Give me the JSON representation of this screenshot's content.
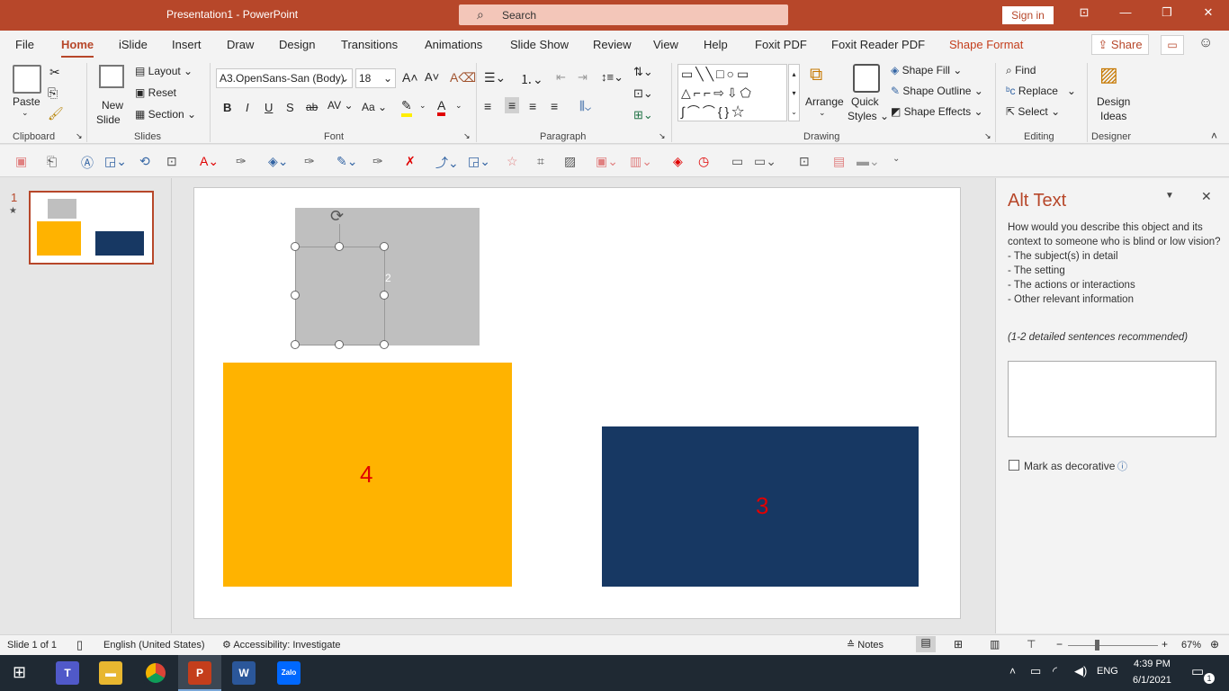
{
  "window": {
    "title": "Presentation1  -  PowerPoint",
    "search_label": "Search",
    "signin_label": "Sign in"
  },
  "menu": {
    "tabs": [
      "File",
      "Home",
      "iSlide",
      "Insert",
      "Draw",
      "Design",
      "Transitions",
      "Animations",
      "Slide Show",
      "Review",
      "View",
      "Help",
      "Foxit PDF",
      "Foxit Reader PDF",
      "Shape Format"
    ],
    "active_tab": "Home",
    "share_label": "Share"
  },
  "ribbon": {
    "clipboard": {
      "paste": "Paste",
      "group": "Clipboard"
    },
    "slides": {
      "new_slide_1": "New",
      "new_slide_2": "Slide",
      "layout": "Layout",
      "reset": "Reset",
      "section": "Section",
      "group": "Slides"
    },
    "font": {
      "font_name": "A3.OpenSans-San (Body)",
      "font_size": "18",
      "bold": "B",
      "italic": "I",
      "underline": "U",
      "shadow": "S",
      "strike": "ab",
      "spacing": "AV",
      "case": "Aa",
      "group": "Font"
    },
    "paragraph": {
      "group": "Paragraph"
    },
    "drawing": {
      "arrange": "Arrange",
      "quick_styles_1": "Quick",
      "quick_styles_2": "Styles",
      "shape_fill": "Shape Fill",
      "shape_outline": "Shape Outline",
      "shape_effects": "Shape Effects",
      "group": "Drawing"
    },
    "editing": {
      "find": "Find",
      "replace": "Replace",
      "select": "Select",
      "group": "Editing"
    },
    "designer": {
      "design_ideas_1": "Design",
      "design_ideas_2": "Ideas",
      "group": "Designer"
    }
  },
  "thumbnails": {
    "slide_number": "1",
    "star": "★"
  },
  "slide": {
    "gray_label": "2",
    "orange_label": "4",
    "navy_label": "3",
    "colors": {
      "gray": "#bfbfbf",
      "orange": "#ffb300",
      "navy": "#173863",
      "label_red": "#e00000"
    }
  },
  "alt_text": {
    "title": "Alt Text",
    "question": "How would you describe this object and its context to someone who is blind or low vision?",
    "bullets": [
      "- The subject(s) in detail",
      "- The setting",
      "- The actions or interactions",
      "- Other relevant information"
    ],
    "hint": "(1-2 detailed sentences recommended)",
    "input_value": "",
    "decorative_label": "Mark as decorative"
  },
  "status": {
    "slide_info": "Slide 1 of 1",
    "language": "English (United States)",
    "accessibility": "Accessibility: Investigate",
    "notes": "Notes",
    "zoom": "67%"
  },
  "taskbar": {
    "time": "4:39 PM",
    "date": "6/1/2021",
    "lang": "ENG",
    "notification_count": "1"
  }
}
